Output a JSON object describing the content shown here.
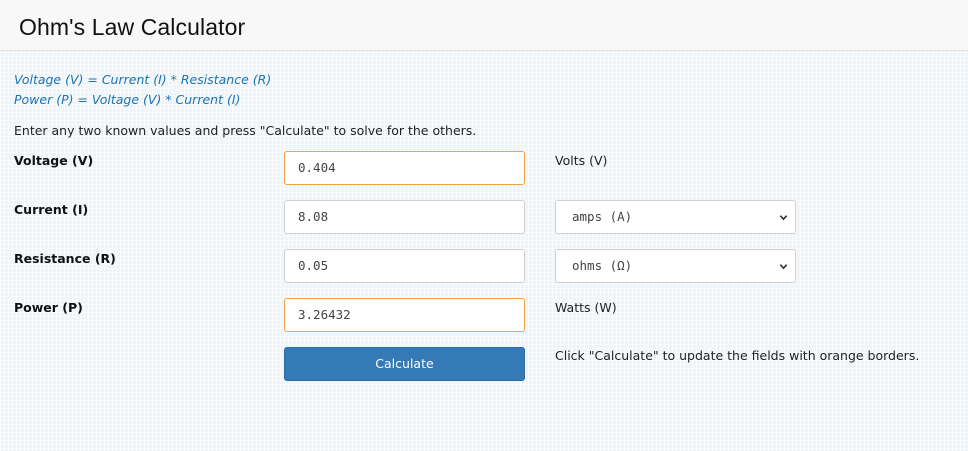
{
  "page": {
    "title": "Ohm's Law Calculator"
  },
  "formulas": {
    "line1": "Voltage (V) = Current (I) * Resistance (R)",
    "line2": "Power (P) = Voltage (V) * Current (I)"
  },
  "instructions": "Enter any two known values and press \"Calculate\" to solve for the others.",
  "rows": {
    "voltage": {
      "label": "Voltage (V)",
      "value": "0.404",
      "unit": "Volts (V)"
    },
    "current": {
      "label": "Current (I)",
      "value": "8.08",
      "unit_selected": "amps (A)"
    },
    "resistance": {
      "label": "Resistance (R)",
      "value": "0.05",
      "unit_selected": "ohms (Ω)"
    },
    "power": {
      "label": "Power (P)",
      "value": "3.26432",
      "unit": "Watts (W)"
    }
  },
  "calculate_button": {
    "label": "Calculate"
  },
  "note": "Click \"Calculate\" to update the fields with orange borders.",
  "colors": {
    "accent": "#337ab7",
    "orange_border": "#f0a14a",
    "formula_text": "#1c74b3"
  },
  "icons": {
    "select_chevron": "chevron-down-icon"
  }
}
